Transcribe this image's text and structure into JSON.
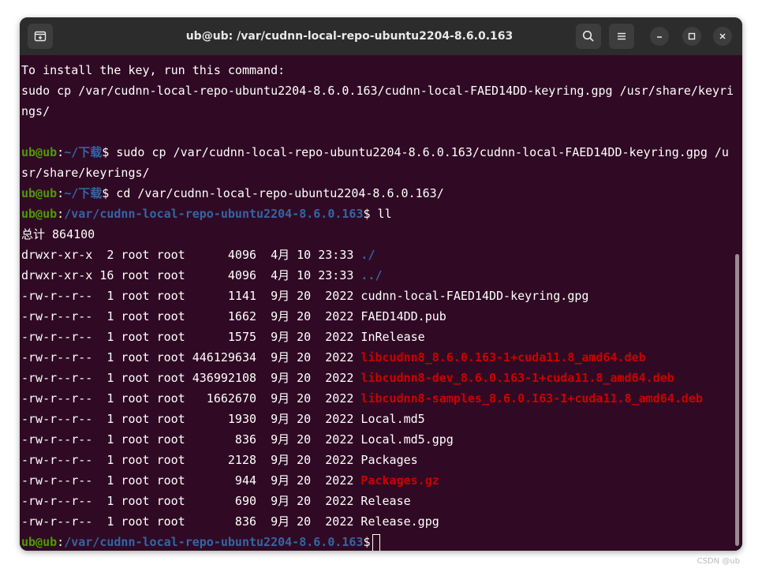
{
  "window": {
    "title": "ub@ub: /var/cudnn-local-repo-ubuntu2204-8.6.0.163"
  },
  "icons": {
    "new_tab": "new-tab-icon",
    "search": "search-icon",
    "menu": "hamburger-menu-icon",
    "minimize": "minimize-icon",
    "maximize": "maximize-icon",
    "close": "close-icon"
  },
  "colors": {
    "background": "#300a24",
    "prompt_user": "#4e9a06",
    "prompt_path": "#3465a4",
    "archive": "#cc0000",
    "titlebar": "#2c2c2c"
  },
  "prompt": {
    "user_host": "ub@ub",
    "colon": ":",
    "dollar": "$",
    "path_home": "~/下载",
    "path_repo": "/var/cudnn-local-repo-ubuntu2204-8.6.0.163"
  },
  "output": {
    "l1": "To install the key, run this command:",
    "l2": "sudo cp /var/cudnn-local-repo-ubuntu2204-8.6.0.163/cudnn-local-FAED14DD-keyring.gpg /usr/share/keyri",
    "l3": "ngs/",
    "cmd1_a": " sudo cp /var/cudnn-local-repo-ubuntu2204-8.6.0.163/cudnn-local-FAED14DD-keyring.gpg /u",
    "cmd1_b": "sr/share/keyrings/",
    "cmd2": " cd /var/cudnn-local-repo-ubuntu2204-8.6.0.163/",
    "cmd3": " ll",
    "total": "总计 864100"
  },
  "listing": [
    {
      "meta": "drwxr-xr-x  2 root root      4096  4月 10 23:33 ",
      "name": "./",
      "kind": "dir"
    },
    {
      "meta": "drwxr-xr-x 16 root root      4096  4月 10 23:33 ",
      "name": "../",
      "kind": "dir"
    },
    {
      "meta": "-rw-r--r--  1 root root      1141  9月 20  2022 ",
      "name": "cudnn-local-FAED14DD-keyring.gpg",
      "kind": "file"
    },
    {
      "meta": "-rw-r--r--  1 root root      1662  9月 20  2022 ",
      "name": "FAED14DD.pub",
      "kind": "file"
    },
    {
      "meta": "-rw-r--r--  1 root root      1575  9月 20  2022 ",
      "name": "InRelease",
      "kind": "file"
    },
    {
      "meta": "-rw-r--r--  1 root root 446129634  9月 20  2022 ",
      "name": "libcudnn8_8.6.0.163-1+cuda11.8_amd64.deb",
      "kind": "archive"
    },
    {
      "meta": "-rw-r--r--  1 root root 436992108  9月 20  2022 ",
      "name": "libcudnn8-dev_8.6.0.163-1+cuda11.8_amd64.deb",
      "kind": "archive"
    },
    {
      "meta": "-rw-r--r--  1 root root   1662670  9月 20  2022 ",
      "name": "libcudnn8-samples_8.6.0.163-1+cuda11.8_amd64.deb",
      "kind": "archive"
    },
    {
      "meta": "-rw-r--r--  1 root root      1930  9月 20  2022 ",
      "name": "Local.md5",
      "kind": "file"
    },
    {
      "meta": "-rw-r--r--  1 root root       836  9月 20  2022 ",
      "name": "Local.md5.gpg",
      "kind": "file"
    },
    {
      "meta": "-rw-r--r--  1 root root      2128  9月 20  2022 ",
      "name": "Packages",
      "kind": "file"
    },
    {
      "meta": "-rw-r--r--  1 root root       944  9月 20  2022 ",
      "name": "Packages.gz",
      "kind": "archive"
    },
    {
      "meta": "-rw-r--r--  1 root root       690  9月 20  2022 ",
      "name": "Release",
      "kind": "file"
    },
    {
      "meta": "-rw-r--r--  1 root root       836  9月 20  2022 ",
      "name": "Release.gpg",
      "kind": "file"
    }
  ],
  "watermark": "CSDN @ub"
}
